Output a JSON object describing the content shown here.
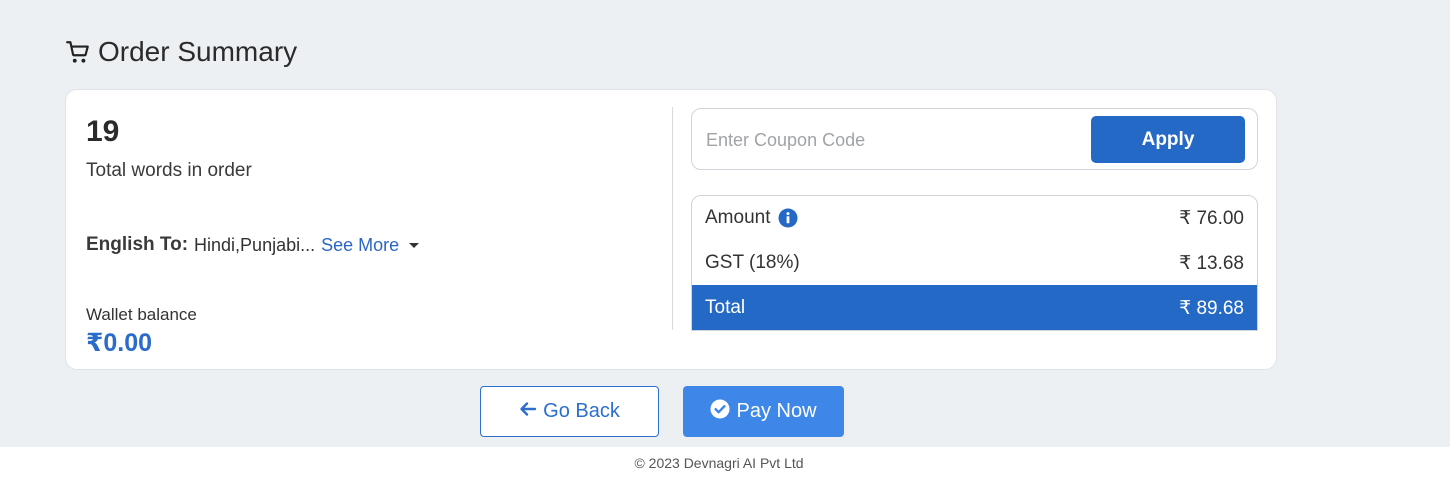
{
  "header": {
    "title": "Order Summary",
    "icon": "cart-icon"
  },
  "order": {
    "word_count": "19",
    "word_label": "Total words in order",
    "lang_label": "English To:",
    "lang_value": "Hindi,Punjabi...",
    "see_more": "See More"
  },
  "wallet": {
    "label": "Wallet balance",
    "value": "₹0.00"
  },
  "coupon": {
    "placeholder": "Enter Coupon Code",
    "apply_label": "Apply"
  },
  "summary": {
    "amount_label": "Amount",
    "amount_value": "₹ 76.00",
    "gst_label": "GST (18%)",
    "gst_value": "₹ 13.68",
    "total_label": "Total",
    "total_value": "₹ 89.68"
  },
  "actions": {
    "back_label": "Go Back",
    "pay_label": "Pay Now"
  },
  "footer": {
    "text": "© 2023 Devnagri AI Pvt Ltd"
  },
  "colors": {
    "primary": "#2469c6",
    "pay": "#3e87e8",
    "wallet": "#2a6bcc"
  }
}
